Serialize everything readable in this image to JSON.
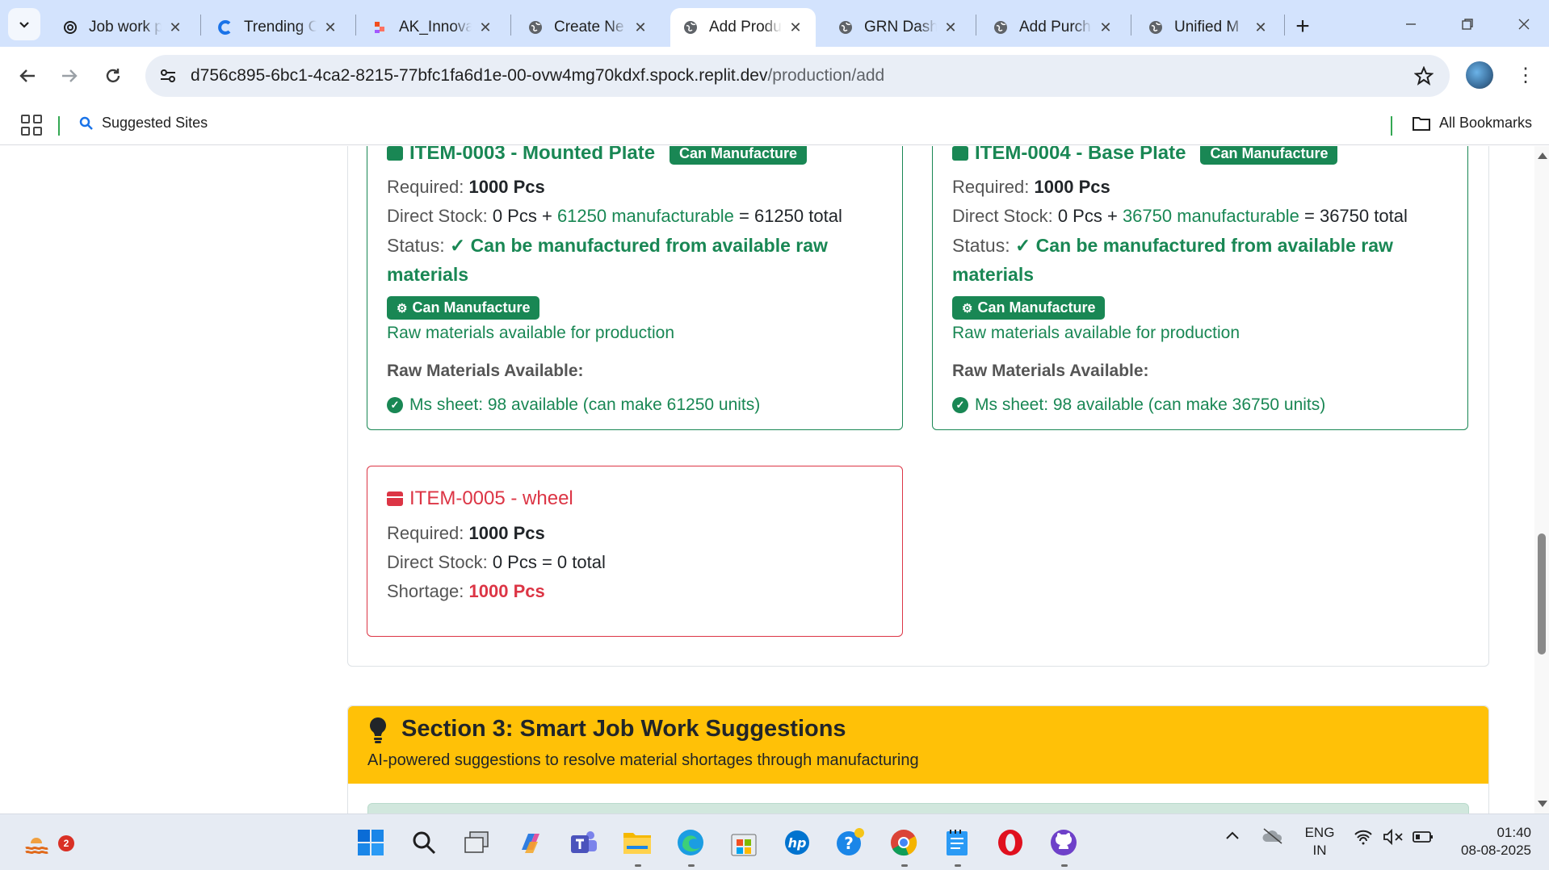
{
  "browser": {
    "tabs": [
      {
        "title": "Job work p",
        "active": false
      },
      {
        "title": "Trending C",
        "active": false
      },
      {
        "title": "AK_Innova",
        "active": false
      },
      {
        "title": "Create Ne",
        "active": false
      },
      {
        "title": "Add Produ",
        "active": true
      },
      {
        "title": "GRN Dashb",
        "active": false
      },
      {
        "title": "Add Purch",
        "active": false
      },
      {
        "title": "Unified M",
        "active": false
      }
    ],
    "url_host": "d756c895-6bc1-4ca2-8215-77bfc1fa6d1e-00-ovw4mg70kdxf.spock.replit.dev",
    "url_path": "/production/add",
    "bookmarks": {
      "suggested": "Suggested Sites",
      "all": "All Bookmarks"
    }
  },
  "items": {
    "item3": {
      "title": "ITEM-0003 - Mounted Plate",
      "title_badge": "Can Manufacture",
      "required_label": "Required:",
      "required_value": "1000 Pcs",
      "direct_label": "Direct Stock:",
      "direct_value": "0 Pcs +",
      "manufacturable": "61250 manufacturable",
      "total": "= 61250 total",
      "status_label": "Status:",
      "status_value": "✓ Can be manufactured from available raw materials",
      "badge": "Can Manufacture",
      "note": "Raw materials available for production",
      "raw_heading": "Raw Materials Available:",
      "raw_item": "Ms sheet: 98 available (can make 61250 units)"
    },
    "item4": {
      "title": "ITEM-0004 - Base Plate",
      "title_badge": "Can Manufacture",
      "required_label": "Required:",
      "required_value": "1000 Pcs",
      "direct_label": "Direct Stock:",
      "direct_value": "0 Pcs +",
      "manufacturable": "36750 manufacturable",
      "total": "= 36750 total",
      "status_label": "Status:",
      "status_value": "✓ Can be manufactured from available raw materials",
      "badge": "Can Manufacture",
      "note": "Raw materials available for production",
      "raw_heading": "Raw Materials Available:",
      "raw_item": "Ms sheet: 98 available (can make 36750 units)"
    },
    "item5": {
      "title": "ITEM-0005 - wheel",
      "required_label": "Required:",
      "required_value": "1000 Pcs",
      "direct_label": "Direct Stock:",
      "direct_value": "0 Pcs = 0 total",
      "shortage_label": "Shortage:",
      "shortage_value": "1000 Pcs"
    }
  },
  "section3": {
    "title": "Section 3: Smart Job Work Suggestions",
    "subtitle": "AI-powered suggestions to resolve material shortages through manufacturing"
  },
  "taskbar": {
    "weather_badge": "2",
    "lang_line1": "ENG",
    "lang_line2": "IN",
    "time": "01:40",
    "date": "08-08-2025"
  },
  "colors": {
    "success": "#198754",
    "danger": "#dc3545",
    "warning": "#ffc107",
    "tabbar": "#d3e3fd"
  }
}
